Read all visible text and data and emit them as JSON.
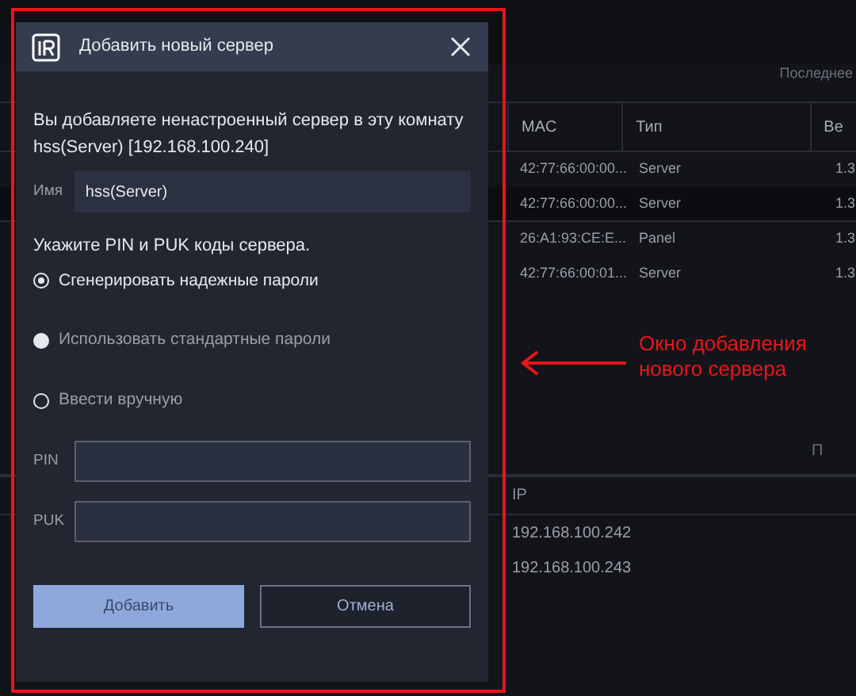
{
  "background": {
    "top_right_label": "Последнее",
    "devices_table": {
      "columns": [
        "MAC",
        "Тип",
        "Ве"
      ],
      "rows": [
        {
          "cells": [
            "42:77:66:00:00...",
            "Server",
            "1.3"
          ],
          "selected": false
        },
        {
          "cells": [
            "42:77:66:00:00...",
            "Server",
            "1.3"
          ],
          "selected": true
        },
        {
          "cells": [
            "26:A1:93:CE:E...",
            "Panel",
            "1.3"
          ],
          "selected": false
        },
        {
          "cells": [
            "42:77:66:00:01...",
            "Server",
            "1.3"
          ],
          "selected": false
        }
      ]
    },
    "second_section_label": "П",
    "ip_table": {
      "columns": [
        "IP"
      ],
      "rows": [
        [
          "192.168.100.242"
        ],
        [
          "192.168.100.243"
        ]
      ]
    }
  },
  "dialog": {
    "title": "Добавить новый сервер",
    "intro": "Вы добавляете ненастроенный сервер в эту комнату hss(Server) [192.168.100.240]",
    "name_field": {
      "label": "Имя",
      "value": "hss(Server)"
    },
    "codes_heading": "Укажите PIN и PUK коды сервера.",
    "options": [
      {
        "label": "Сгенерировать надежные пароли",
        "selected": true
      },
      {
        "label": "Использовать стандартные пароли",
        "selected": false
      },
      {
        "label": "Ввести вручную",
        "selected": false
      }
    ],
    "fields": [
      {
        "label": "PIN"
      },
      {
        "label": "PUK"
      }
    ],
    "buttons": [
      {
        "label": "Добавить",
        "kind": "primary"
      },
      {
        "label": "Отмена",
        "kind": "secondary"
      }
    ]
  },
  "annotation": {
    "text": "Окно добавления нового сервера"
  }
}
